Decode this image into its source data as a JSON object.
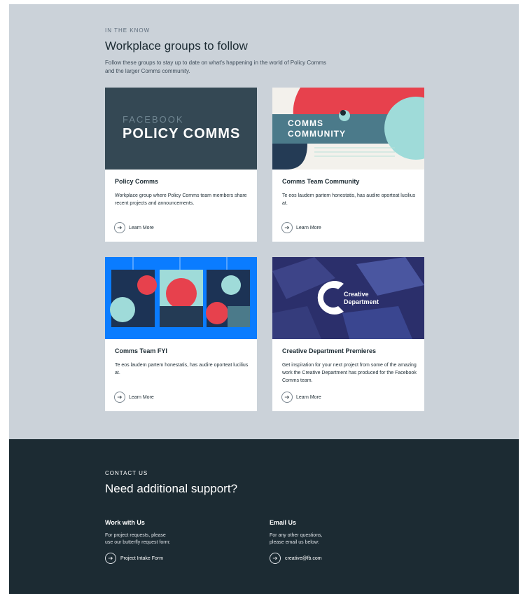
{
  "groups": {
    "eyebrow": "IN THE KNOW",
    "heading": "Workplace groups to follow",
    "intro": "Follow these groups to stay up to date on what's happening in the world of Policy Comms and the larger Comms community.",
    "cards": [
      {
        "title": "Policy Comms",
        "description": "Workplace group where Policy Comms team members share recent projects and announcements.",
        "link": "Learn More",
        "image_text": {
          "line1": "FACEBOOK",
          "line2": "POLICY COMMS"
        }
      },
      {
        "title": "Comms Team Community",
        "description": "Te eos laudem partem honestatis, has audire oporteat lucilius at.",
        "link": "Learn More",
        "image_text": {
          "line1": "COMMS",
          "line2": "COMMUNITY"
        }
      },
      {
        "title": "Comms Team FYI",
        "description": "Te eos laudem partem honestatis, has audire oporteat lucilius at.",
        "link": "Learn More"
      },
      {
        "title": "Creative Department Premieres",
        "description": "Get inspiration for your next project from some of the amazing work the Creative Department has produced for the Facebook Comms team.",
        "link": "Learn More",
        "image_text": {
          "line1": "Creative",
          "line2": "Department"
        }
      }
    ]
  },
  "contact": {
    "eyebrow": "CONTACT US",
    "heading": "Need additional support?",
    "work": {
      "title": "Work with Us",
      "line1": "For project requests, please",
      "line2": "use our butterfly request form:",
      "link": "Project Intake Form"
    },
    "email": {
      "title": "Email Us",
      "line1": "For any other questions,",
      "line2": "please email us below:",
      "link": "creative@fb.com"
    }
  },
  "colors": {
    "section_bg": "#cbd2d9",
    "footer_bg": "#1c2b33",
    "policy_bg": "#344854",
    "accent_red": "#e7414d",
    "accent_teal": "#9fdbd9",
    "accent_blue": "#0a7cff"
  },
  "icons": [
    "arrow-right-icon"
  ]
}
